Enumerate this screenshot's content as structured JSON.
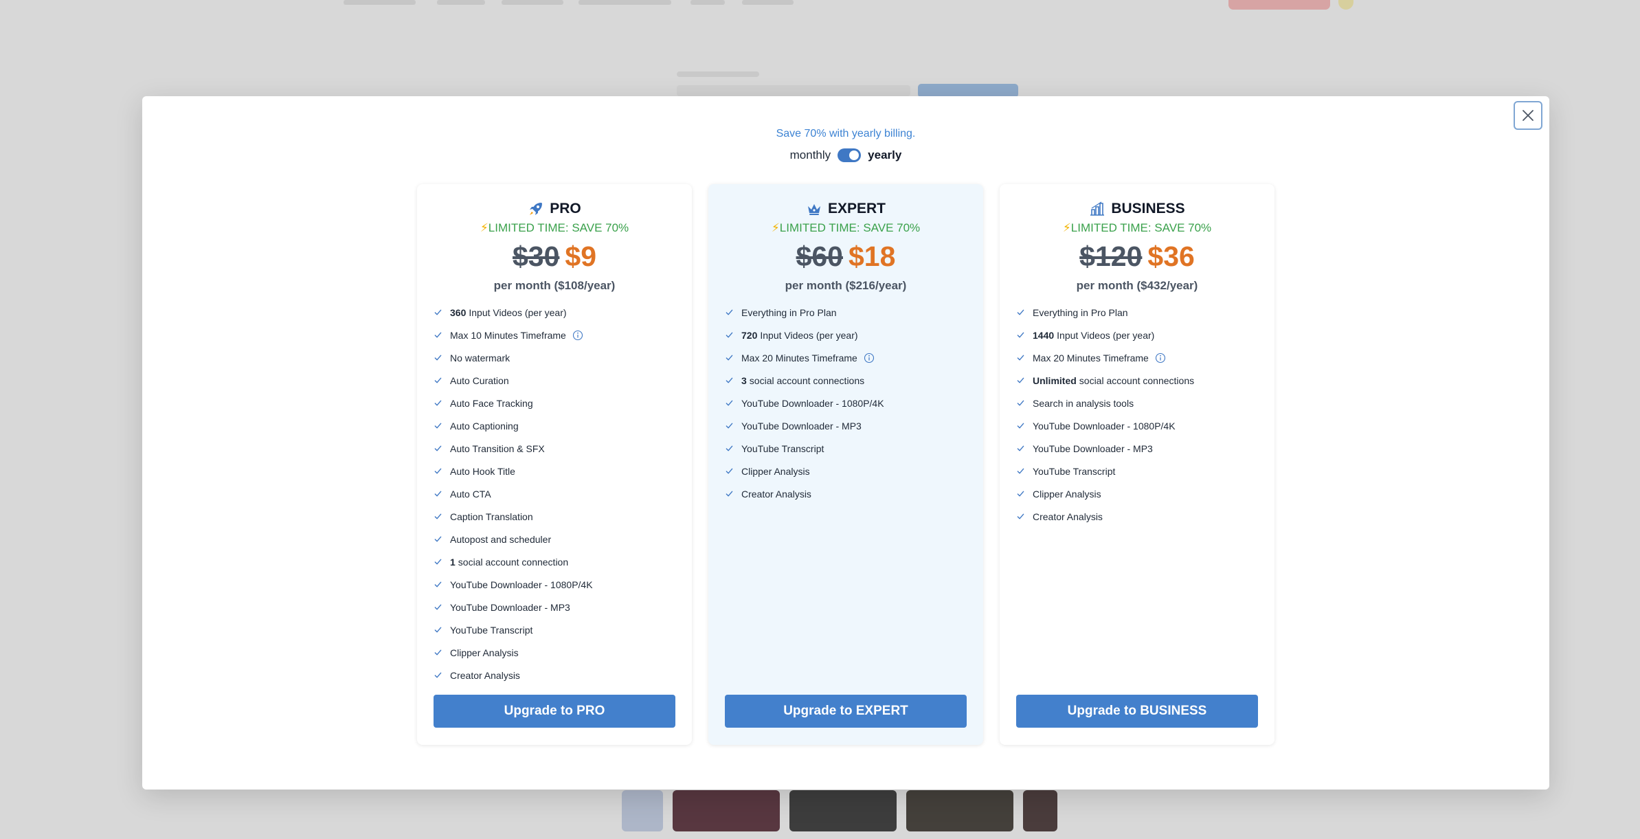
{
  "modal": {
    "promo_text": "Save 70% with yearly billing.",
    "billing": {
      "monthly_label": "monthly",
      "yearly_label": "yearly",
      "selected": "yearly"
    }
  },
  "plans": [
    {
      "name": "PRO",
      "icon": "rocket-icon",
      "limited": "LIMITED TIME: SAVE 70%",
      "old_price": "$30",
      "new_price": "$9",
      "period": "per month ($108/year)",
      "features": [
        {
          "bold": "360",
          "text": "Input Videos (per year)",
          "info": false
        },
        {
          "bold": "",
          "text": "Max 10 Minutes Timeframe",
          "info": true
        },
        {
          "bold": "",
          "text": "No watermark",
          "info": false
        },
        {
          "bold": "",
          "text": "Auto Curation",
          "info": false
        },
        {
          "bold": "",
          "text": "Auto Face Tracking",
          "info": false
        },
        {
          "bold": "",
          "text": "Auto Captioning",
          "info": false
        },
        {
          "bold": "",
          "text": "Auto Transition & SFX",
          "info": false
        },
        {
          "bold": "",
          "text": "Auto Hook Title",
          "info": false
        },
        {
          "bold": "",
          "text": "Auto CTA",
          "info": false
        },
        {
          "bold": "",
          "text": "Caption Translation",
          "info": false
        },
        {
          "bold": "",
          "text": "Autopost and scheduler",
          "info": false
        },
        {
          "bold": "1",
          "text": "social account connection",
          "info": false
        },
        {
          "bold": "",
          "text": "YouTube Downloader - 1080P/4K",
          "info": false
        },
        {
          "bold": "",
          "text": "YouTube Downloader - MP3",
          "info": false
        },
        {
          "bold": "",
          "text": "YouTube Transcript",
          "info": false
        },
        {
          "bold": "",
          "text": "Clipper Analysis",
          "info": false
        },
        {
          "bold": "",
          "text": "Creator Analysis",
          "info": false
        }
      ],
      "button": "Upgrade to PRO"
    },
    {
      "name": "EXPERT",
      "icon": "crown-icon",
      "limited": "LIMITED TIME: SAVE 70%",
      "old_price": "$60",
      "new_price": "$18",
      "period": "per month ($216/year)",
      "features": [
        {
          "bold": "",
          "text": "Everything in Pro Plan",
          "info": false
        },
        {
          "bold": "720",
          "text": "Input Videos (per year)",
          "info": false
        },
        {
          "bold": "",
          "text": "Max 20 Minutes Timeframe",
          "info": true
        },
        {
          "bold": "3",
          "text": "social account connections",
          "info": false
        },
        {
          "bold": "",
          "text": "YouTube Downloader - 1080P/4K",
          "info": false
        },
        {
          "bold": "",
          "text": "YouTube Downloader - MP3",
          "info": false
        },
        {
          "bold": "",
          "text": "YouTube Transcript",
          "info": false
        },
        {
          "bold": "",
          "text": "Clipper Analysis",
          "info": false
        },
        {
          "bold": "",
          "text": "Creator Analysis",
          "info": false
        }
      ],
      "button": "Upgrade to EXPERT"
    },
    {
      "name": "BUSINESS",
      "icon": "building-chart-icon",
      "limited": "LIMITED TIME: SAVE 70%",
      "old_price": "$120",
      "new_price": "$36",
      "period": "per month ($432/year)",
      "features": [
        {
          "bold": "",
          "text": "Everything in Pro Plan",
          "info": false
        },
        {
          "bold": "1440",
          "text": "Input Videos (per year)",
          "info": false
        },
        {
          "bold": "",
          "text": "Max 20 Minutes Timeframe",
          "info": true
        },
        {
          "bold": "Unlimited",
          "text": "social account connections",
          "info": false
        },
        {
          "bold": "",
          "text": "Search in analysis tools",
          "info": false
        },
        {
          "bold": "",
          "text": "YouTube Downloader - 1080P/4K",
          "info": false
        },
        {
          "bold": "",
          "text": "YouTube Downloader - MP3",
          "info": false
        },
        {
          "bold": "",
          "text": "YouTube Transcript",
          "info": false
        },
        {
          "bold": "",
          "text": "Clipper Analysis",
          "info": false
        },
        {
          "bold": "",
          "text": "Creator Analysis",
          "info": false
        }
      ],
      "button": "Upgrade to BUSINESS"
    }
  ],
  "colors": {
    "accent": "#4380cc",
    "promo": "#3d83d3",
    "limited_green": "#3aa14b",
    "sale_orange": "#e07424",
    "featured_bg": "#eff7fd"
  }
}
